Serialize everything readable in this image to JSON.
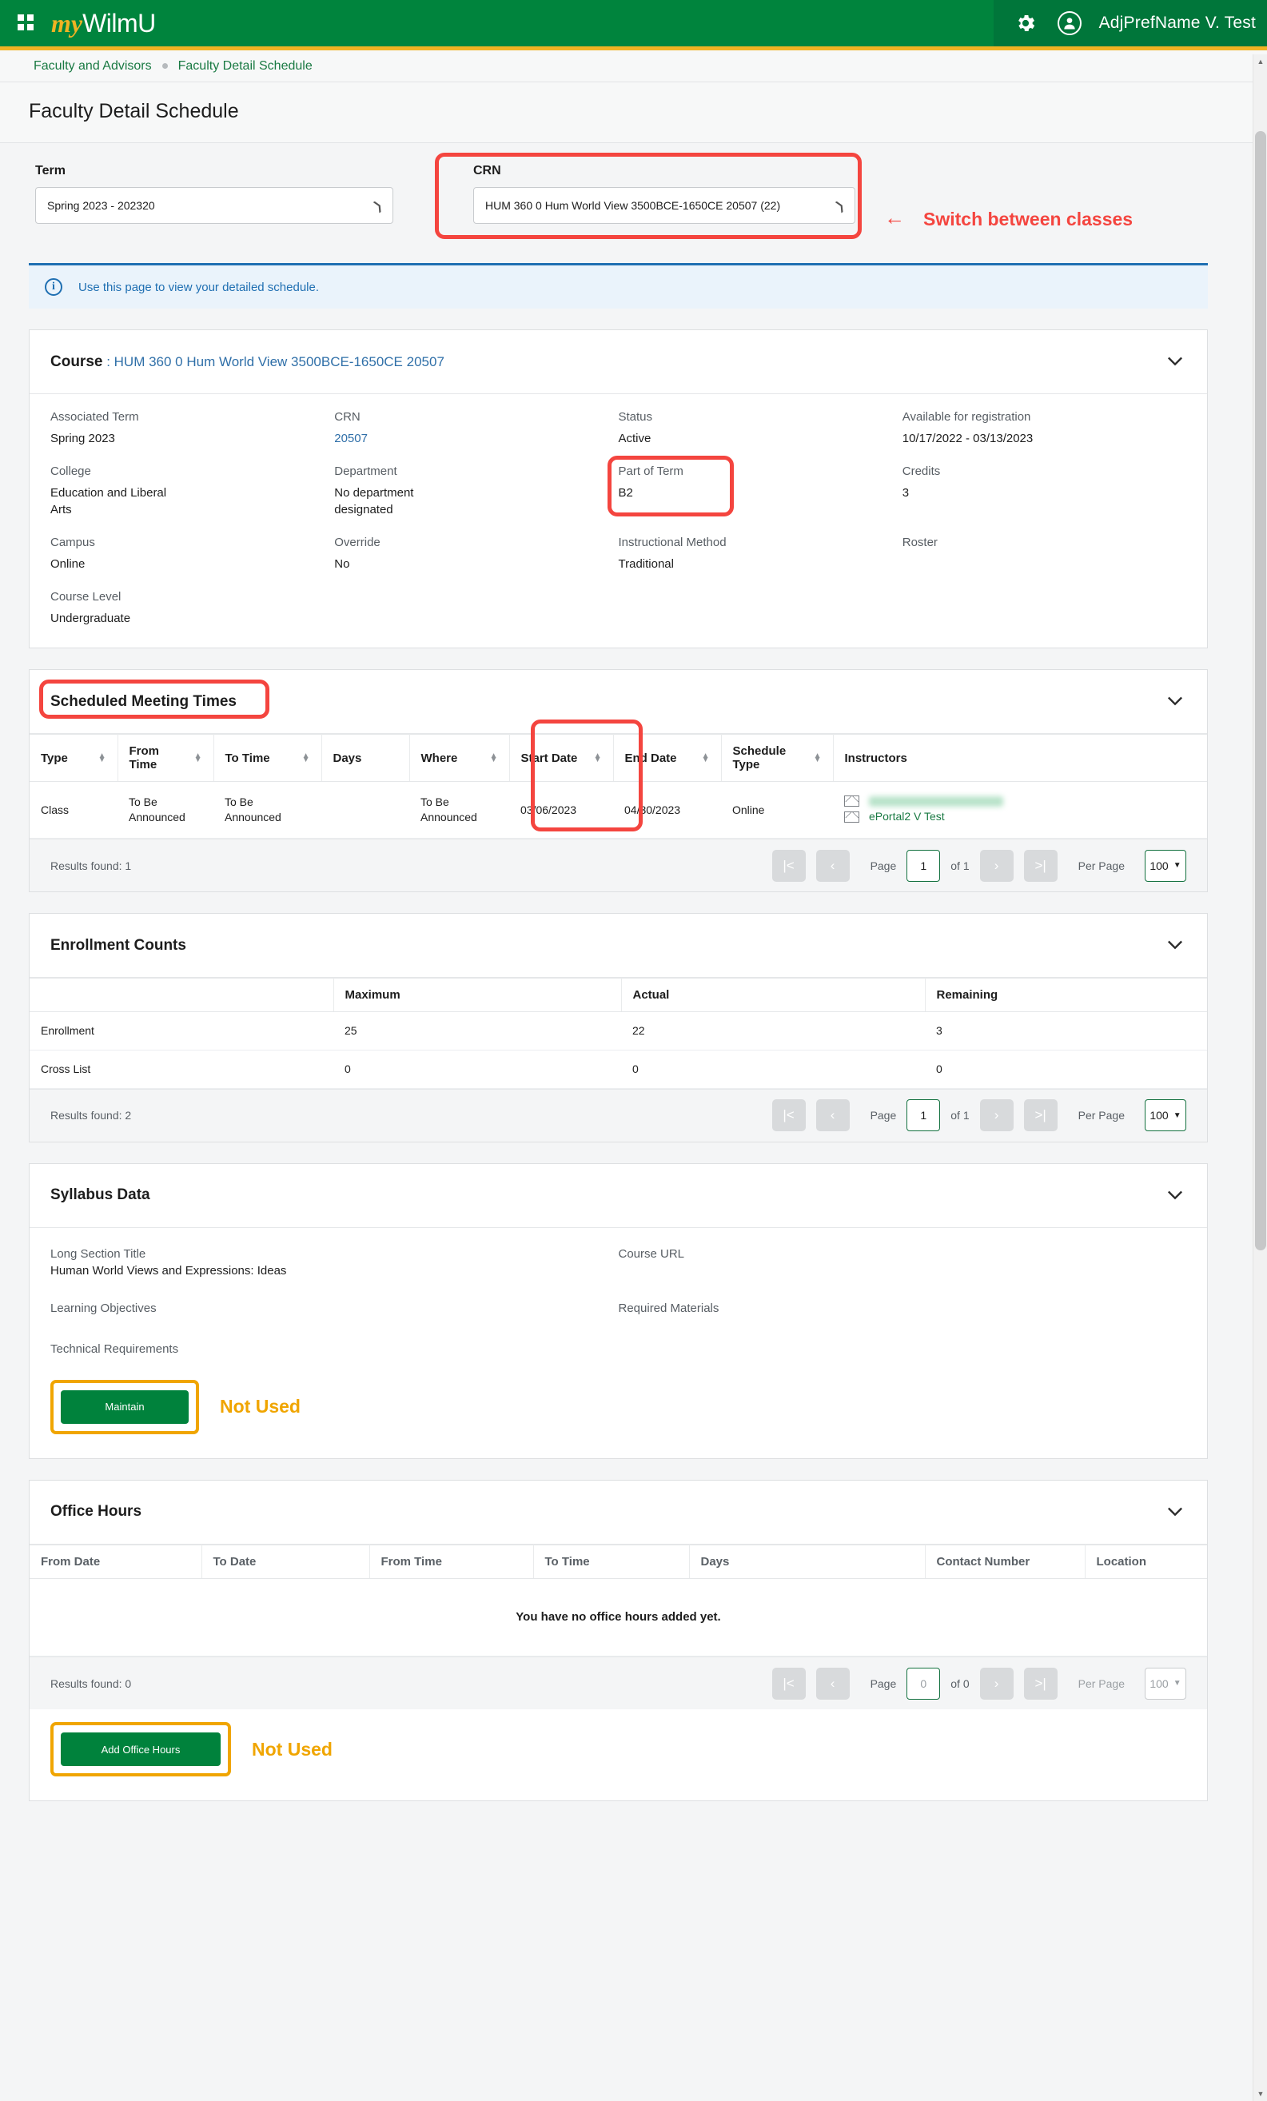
{
  "header": {
    "brand_my": "my",
    "brand_wilmu": "WilmU",
    "grid_icon": "apps-grid-icon",
    "gear_icon": "gear-icon",
    "avatar_icon": "user-avatar-icon",
    "username": "AdjPrefName V. Test"
  },
  "breadcrumb": {
    "items": [
      "Faculty and Advisors",
      "Faculty Detail Schedule"
    ]
  },
  "page": {
    "title": "Faculty Detail Schedule"
  },
  "filters": {
    "term_label": "Term",
    "term_value": "Spring 2023 - 202320",
    "crn_label": "CRN",
    "crn_value": "HUM 360 0 Hum World View 3500BCE-1650CE 20507 (22)"
  },
  "annotations": {
    "switch_classes": "Switch between classes",
    "switch_arrow": "←",
    "not_used_syllabus": "Not Used",
    "not_used_office": "Not Used"
  },
  "info_banner": {
    "icon": "info-circle-icon",
    "text": "Use this page to view your detailed schedule."
  },
  "course": {
    "heading_label": "Course",
    "heading_sep": " : ",
    "heading_value": "HUM 360 0 Hum World View 3500BCE-1650CE 20507",
    "fields": [
      {
        "key": "Associated Term",
        "value": "Spring 2023"
      },
      {
        "key": "CRN",
        "value": "20507",
        "link": true
      },
      {
        "key": "Status",
        "value": "Active"
      },
      {
        "key": "Available for registration",
        "value": "10/17/2022 - 03/13/2023"
      },
      {
        "key": "College",
        "value": "Education and Liberal Arts"
      },
      {
        "key": "Department",
        "value": "No department designated"
      },
      {
        "key": "Part of Term",
        "value": "B2",
        "highlight": true
      },
      {
        "key": "Credits",
        "value": "3"
      },
      {
        "key": "Campus",
        "value": "Online"
      },
      {
        "key": "Override",
        "value": "No"
      },
      {
        "key": "Instructional Method",
        "value": "Traditional"
      },
      {
        "key": "Roster",
        "value": ""
      },
      {
        "key": "Course Level",
        "value": "Undergraduate"
      }
    ]
  },
  "meeting_times": {
    "title": "Scheduled Meeting Times",
    "columns": [
      {
        "label": "Type",
        "sortable": true
      },
      {
        "label": "From Time",
        "sortable": true
      },
      {
        "label": "To Time",
        "sortable": true
      },
      {
        "label": "Days",
        "sortable": false
      },
      {
        "label": "Where",
        "sortable": true,
        "highlight": true
      },
      {
        "label": "Start Date",
        "sortable": true
      },
      {
        "label": "End Date",
        "sortable": true
      },
      {
        "label": "Schedule Type",
        "sortable": true
      },
      {
        "label": "Instructors",
        "sortable": false
      }
    ],
    "row": {
      "type": "Class",
      "from_time": "To Be Announced",
      "to_time": "To Be Announced",
      "days": "",
      "where": "To Be Announced",
      "start_date": "03/06/2023",
      "end_date": "04/30/2023",
      "schedule_type": "Online",
      "instructors": [
        {
          "name": "",
          "redacted": true
        },
        {
          "name": "ePortal2 V Test",
          "redacted": false
        }
      ]
    },
    "pager": {
      "found": "Results found: 1",
      "page_label": "Page",
      "page_value": "1",
      "of_label": "of 1",
      "per_page_label": "Per Page",
      "per_page_value": "100",
      "first_icon": "|<",
      "prev_icon": "‹",
      "next_icon": "›",
      "last_icon": ">|"
    }
  },
  "enrollment": {
    "title": "Enrollment Counts",
    "columns": [
      "",
      "Maximum",
      "Actual",
      "Remaining"
    ],
    "rows": [
      {
        "label": "Enrollment",
        "maximum": "25",
        "actual": "22",
        "remaining": "3"
      },
      {
        "label": "Cross List",
        "maximum": "0",
        "actual": "0",
        "remaining": "0"
      }
    ],
    "pager": {
      "found": "Results found: 2",
      "page_label": "Page",
      "page_value": "1",
      "of_label": "of 1",
      "per_page_label": "Per Page",
      "per_page_value": "100",
      "first_icon": "|<",
      "prev_icon": "‹",
      "next_icon": "›",
      "last_icon": ">|"
    }
  },
  "syllabus": {
    "title": "Syllabus Data",
    "fields": [
      {
        "key": "Long Section Title",
        "value": "Human World Views and Expressions: Ideas"
      },
      {
        "key": "Course URL",
        "value": ""
      },
      {
        "key": "Learning Objectives",
        "value": ""
      },
      {
        "key": "Required Materials",
        "value": ""
      },
      {
        "key": "Technical Requirements",
        "value": ""
      }
    ],
    "maintain_button": "Maintain"
  },
  "office_hours": {
    "title": "Office Hours",
    "columns": [
      "From Date",
      "To Date",
      "From Time",
      "To Time",
      "Days",
      "Contact Number",
      "Location"
    ],
    "empty_message": "You have no office hours added yet.",
    "add_button": "Add Office Hours",
    "pager": {
      "found": "Results found: 0",
      "page_label": "Page",
      "page_value": "0",
      "of_label": "of 0",
      "per_page_label": "Per Page",
      "per_page_value": "100",
      "first_icon": "|<",
      "prev_icon": "‹",
      "next_icon": "›",
      "last_icon": ">|"
    }
  },
  "colors": {
    "brand_green": "#00843d",
    "accent_gold": "#f0b323",
    "annotation_red": "#f4453f",
    "annotation_gold": "#f0a500",
    "link_green": "#1a7a43",
    "info_blue": "#1f6fb2"
  }
}
